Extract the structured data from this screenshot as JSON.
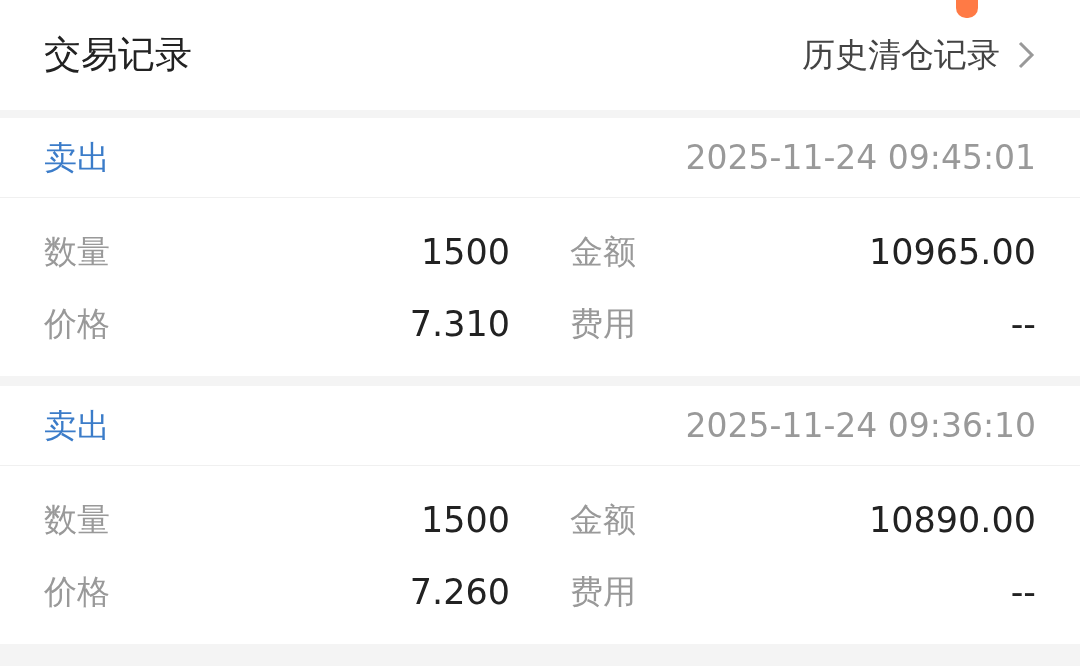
{
  "header": {
    "title": "交易记录",
    "link": "历史清仓记录"
  },
  "records": [
    {
      "side": "卖出",
      "kind": "sell",
      "time": "2025-11-24 09:45:01",
      "fields": [
        {
          "label": "数量",
          "value": "1500"
        },
        {
          "label": "金额",
          "value": "10965.00"
        },
        {
          "label": "价格",
          "value": "7.310"
        },
        {
          "label": "费用",
          "value": "--"
        }
      ]
    },
    {
      "side": "卖出",
      "kind": "sell",
      "time": "2025-11-24 09:36:10",
      "fields": [
        {
          "label": "数量",
          "value": "1500"
        },
        {
          "label": "金额",
          "value": "10890.00"
        },
        {
          "label": "价格",
          "value": "7.260"
        },
        {
          "label": "费用",
          "value": "--"
        }
      ]
    }
  ]
}
